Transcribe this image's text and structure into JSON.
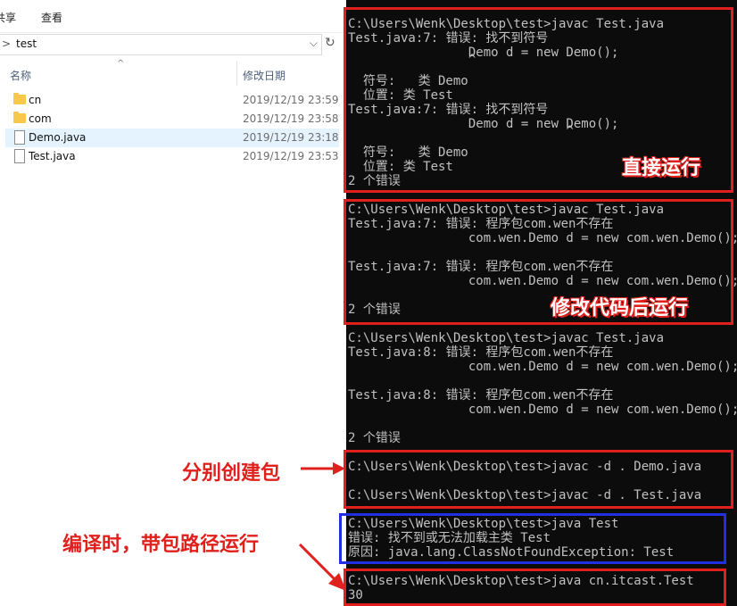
{
  "ribbon": {
    "tab_share": "共享",
    "tab_view": "查看"
  },
  "address": {
    "chevron": ">",
    "path": "test",
    "dropdown": "⌵",
    "refresh": "↻"
  },
  "columns": {
    "name": "名称",
    "date": "修改日期",
    "sort_caret": "^"
  },
  "files": [
    {
      "name": "cn",
      "date": "2019/12/19 23:59",
      "type": "folder"
    },
    {
      "name": "com",
      "date": "2019/12/19 23:58",
      "type": "folder"
    },
    {
      "name": "Demo.java",
      "date": "2019/12/19 23:18",
      "type": "file"
    },
    {
      "name": "Test.java",
      "date": "2019/12/19 23:53",
      "type": "file"
    }
  ],
  "terminal": {
    "lines": [
      "C:\\Users\\Wenk\\Desktop\\test>javac Test.java",
      "Test.java:7: 错误: 找不到符号",
      "                Demo d = new Demo();",
      "                ^",
      "  符号:   类 Demo",
      "  位置: 类 Test",
      "Test.java:7: 错误: 找不到符号",
      "                Demo d = new Demo();",
      "                             ^",
      "  符号:   类 Demo",
      "  位置: 类 Test",
      "2 个错误",
      "C:\\Users\\Wenk\\Desktop\\test>javac Test.java",
      "Test.java:7: 错误: 程序包com.wen不存在",
      "                com.wen.Demo d = new com.wen.Demo();",
      "Test.java:7: 错误: 程序包com.wen不存在",
      "                com.wen.Demo d = new com.wen.Demo();",
      "2 个错误",
      "C:\\Users\\Wenk\\Desktop\\test>javac Test.java",
      "Test.java:8: 错误: 程序包com.wen不存在",
      "                com.wen.Demo d = new com.wen.Demo();",
      "Test.java:8: 错误: 程序包com.wen不存在",
      "                com.wen.Demo d = new com.wen.Demo();",
      "2 个错误",
      "C:\\Users\\Wenk\\Desktop\\test>javac -d . Demo.java",
      "C:\\Users\\Wenk\\Desktop\\test>javac -d . Test.java",
      "C:\\Users\\Wenk\\Desktop\\test>java Test",
      "错误: 找不到或无法加载主类 Test",
      "原因: java.lang.ClassNotFoundException: Test",
      "C:\\Users\\Wenk\\Desktop\\test>java cn.itcast.Test",
      "30"
    ]
  },
  "annotations": {
    "direct_run": "直接运行",
    "after_edit": "修改代码后运行",
    "create_packages": "分别创建包",
    "run_with_package": "编译时，带包路径运行"
  },
  "colors": {
    "red": "#e0201c",
    "blue": "#2030e0",
    "terminal_bg": "#0c0c0c",
    "terminal_text": "#c0c0c0"
  }
}
